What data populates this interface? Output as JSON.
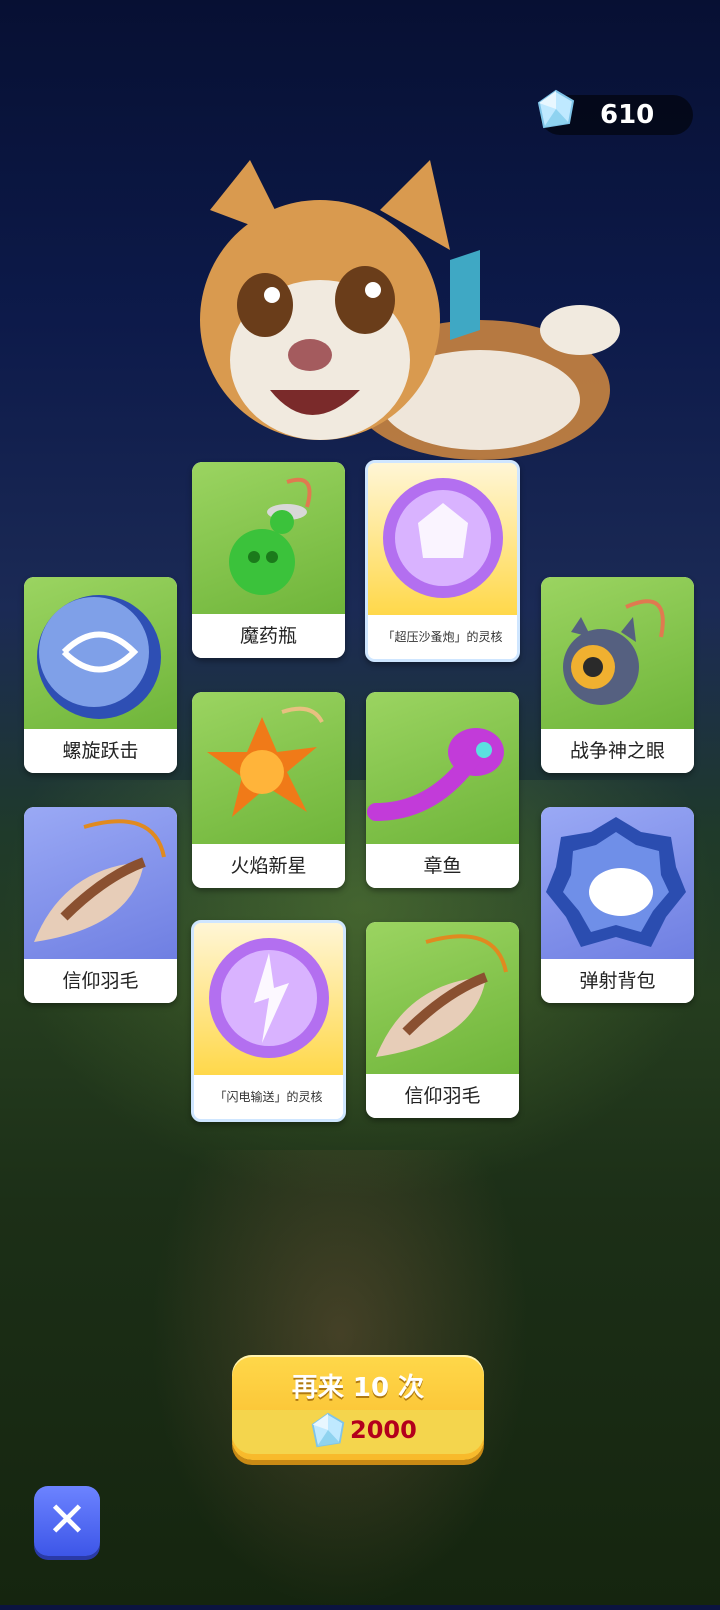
{
  "currency": {
    "amount": "610",
    "icon": "crystal-gem-icon"
  },
  "cards": [
    {
      "id": "c1",
      "name": "魔药瓶",
      "rarity": "green",
      "icon": "potion-bottle-icon"
    },
    {
      "id": "c2",
      "name": "「超压沙蚤炮」的灵核",
      "rarity": "rare",
      "icon": "purple-core-orb-icon"
    },
    {
      "id": "c3",
      "name": "螺旋跃击",
      "rarity": "green",
      "icon": "spiral-orb-icon"
    },
    {
      "id": "c4",
      "name": "战争神之眼",
      "rarity": "green",
      "icon": "war-eye-icon"
    },
    {
      "id": "c5",
      "name": "火焰新星",
      "rarity": "green",
      "icon": "flame-star-icon"
    },
    {
      "id": "c6",
      "name": "章鱼",
      "rarity": "green",
      "icon": "octopus-icon"
    },
    {
      "id": "c7",
      "name": "信仰羽毛",
      "rarity": "blue",
      "icon": "feather-icon"
    },
    {
      "id": "c8",
      "name": "弹射背包",
      "rarity": "blue",
      "icon": "bounce-backpack-icon"
    },
    {
      "id": "c9",
      "name": "「闪电输送」的灵核",
      "rarity": "rare",
      "icon": "lightning-core-orb-icon"
    },
    {
      "id": "c10",
      "name": "信仰羽毛",
      "rarity": "green",
      "icon": "feather-icon"
    }
  ],
  "again_button": {
    "label": "再来 10 次",
    "cost": "2000"
  },
  "close_button": {
    "icon": "close-x-icon"
  },
  "colors": {
    "accent_gold": "#f8b92a",
    "cost_red": "#b3001c",
    "close_blue": "#3d56e8"
  }
}
